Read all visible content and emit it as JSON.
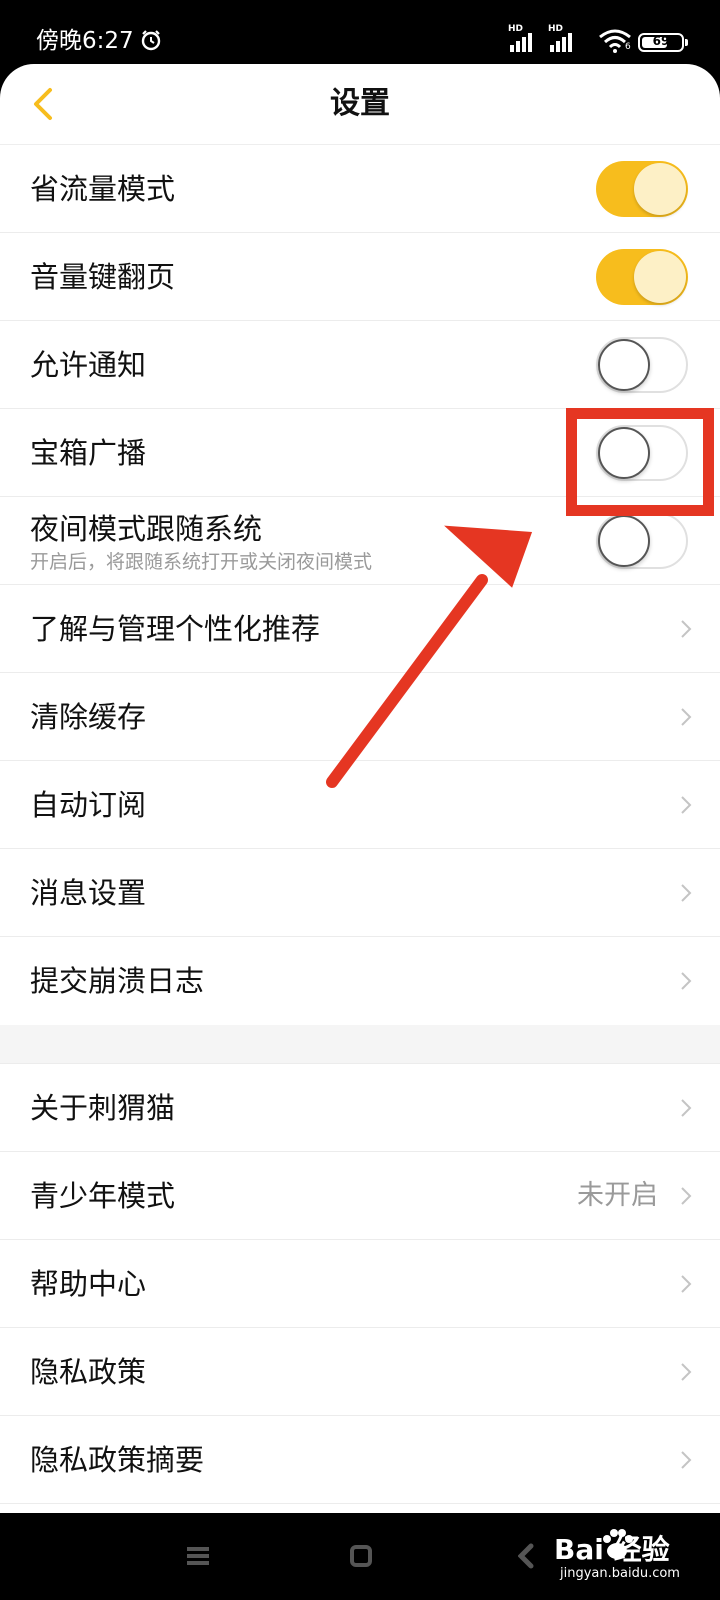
{
  "status_bar": {
    "time": "傍晚6:27",
    "signal1_badge": "HD",
    "signal2_badge": "HD",
    "wifi_badge": "6",
    "battery": "69",
    "battery_level": 0.69
  },
  "header": {
    "title": "设置",
    "back_icon": "chevron-left-icon",
    "accent_color": "#f7bd1d"
  },
  "toggle_rows": [
    {
      "label": "省流量模式",
      "on": true
    },
    {
      "label": "音量键翻页",
      "on": true
    },
    {
      "label": "允许通知",
      "on": false
    },
    {
      "label": "宝箱广播",
      "on": false
    },
    {
      "label": "夜间模式跟随系统",
      "subtitle": "开启后，将跟随系统打开或关闭夜间模式",
      "on": false
    }
  ],
  "nav_rows_1": [
    {
      "label": "了解与管理个性化推荐"
    },
    {
      "label": "清除缓存"
    },
    {
      "label": "自动订阅"
    },
    {
      "label": "消息设置"
    },
    {
      "label": "提交崩溃日志"
    }
  ],
  "nav_rows_2": [
    {
      "label": "关于刺猬猫"
    },
    {
      "label": "青少年模式",
      "value": "未开启"
    },
    {
      "label": "帮助中心"
    },
    {
      "label": "隐私政策"
    },
    {
      "label": "隐私政策摘要"
    }
  ],
  "annotation": {
    "color": "#e53622"
  },
  "watermark": {
    "brand": "Bai  经验",
    "url": "jingyan.baidu.com"
  }
}
